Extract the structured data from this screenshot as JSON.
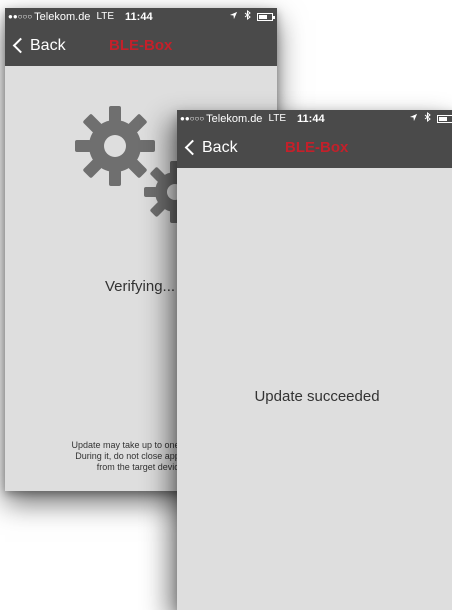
{
  "back_screen": {
    "status": {
      "signal": "●●○○○",
      "carrier": "Telekom.de",
      "network": "LTE",
      "time": "11:44",
      "location_icon": "location-arrow-icon",
      "bluetooth_icon": "bluetooth-icon",
      "battery_icon": "battery-icon"
    },
    "nav": {
      "back_label": "Back",
      "title": "BLE-Box"
    },
    "body": {
      "gears_icon": "gears-icon",
      "status_text": "Verifying...",
      "note_line1": "Update may take up to one minute.",
      "note_line2": "During it, do not close application",
      "note_line3": "from the target device."
    }
  },
  "front_screen": {
    "status": {
      "signal": "●●○○○",
      "carrier": "Telekom.de",
      "network": "LTE",
      "time": "11:44",
      "location_icon": "location-arrow-icon",
      "bluetooth_icon": "bluetooth-icon",
      "battery_icon": "battery-icon"
    },
    "nav": {
      "back_label": "Back",
      "title": "BLE-Box"
    },
    "body": {
      "status_text": "Update succeeded"
    }
  },
  "colors": {
    "bar_background": "#4a4a4a",
    "title_red": "#c4202a",
    "screen_background": "#dedede",
    "gear_color": "#6f6f6f"
  }
}
